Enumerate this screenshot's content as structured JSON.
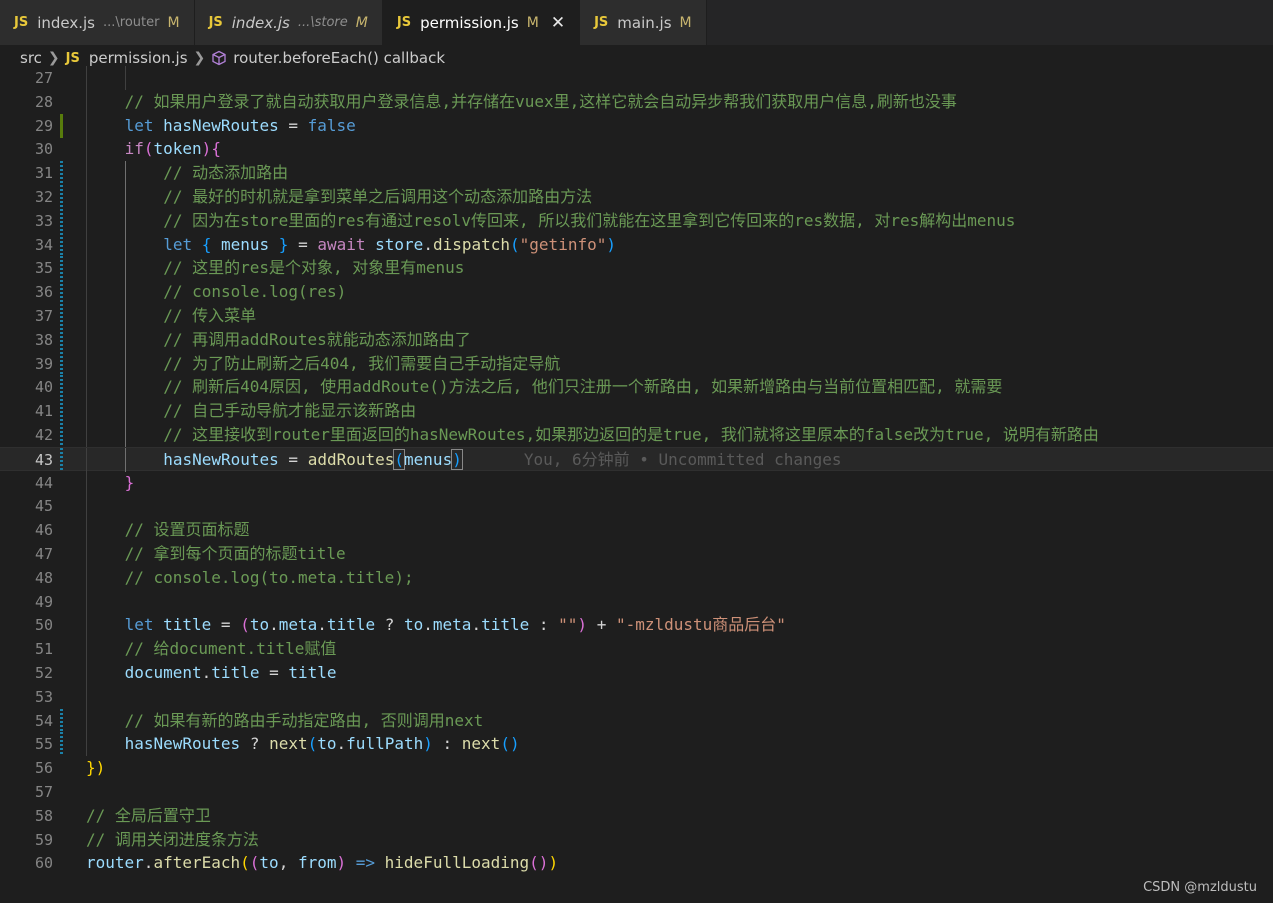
{
  "tabs": [
    {
      "icon": "JS",
      "name": "index.js",
      "path": "...\\router",
      "status": "M",
      "italic": false,
      "active": false
    },
    {
      "icon": "JS",
      "name": "index.js",
      "path": "...\\store",
      "status": "M",
      "italic": true,
      "active": false
    },
    {
      "icon": "JS",
      "name": "permission.js",
      "path": "",
      "status": "M",
      "italic": false,
      "active": true,
      "close": "✕"
    },
    {
      "icon": "JS",
      "name": "main.js",
      "path": "",
      "status": "M",
      "italic": false,
      "active": false
    }
  ],
  "breadcrumb": {
    "folder": "src",
    "file_icon": "JS",
    "file": "permission.js",
    "symbol_icon": "cube-icon",
    "symbol": "router.beforeEach() callback"
  },
  "editor": {
    "current_line": 43,
    "blame_text": "You, 6分钟前 • Uncommitted changes",
    "lines": [
      {
        "n": "27",
        "indent": 2,
        "tokens": []
      },
      {
        "n": "28",
        "indent": 1,
        "tokens": [
          {
            "t": "// 如果用户登录了就自动获取用户登录信息,并存储在vuex里,这样它就会自动异步帮我们获取用户信息,刷新也没事",
            "c": "c"
          }
        ]
      },
      {
        "n": "29",
        "indent": 1,
        "gutter": "added",
        "tokens": [
          {
            "t": "let ",
            "c": "k"
          },
          {
            "t": "hasNewRoutes",
            "c": "v"
          },
          {
            "t": " = ",
            "c": "p"
          },
          {
            "t": "false",
            "c": "k"
          }
        ]
      },
      {
        "n": "30",
        "indent": 1,
        "tokens": [
          {
            "t": "if",
            "c": "kc"
          },
          {
            "t": "(",
            "c": "b2"
          },
          {
            "t": "token",
            "c": "v"
          },
          {
            "t": ")",
            "c": "b2"
          },
          {
            "t": "{",
            "c": "b2"
          }
        ]
      },
      {
        "n": "31",
        "indent": 2,
        "gutter": "modified",
        "tokens": [
          {
            "t": "// 动态添加路由",
            "c": "c"
          }
        ]
      },
      {
        "n": "32",
        "indent": 2,
        "gutter": "modified",
        "tokens": [
          {
            "t": "// 最好的时机就是拿到菜单之后调用这个动态添加路由方法",
            "c": "c"
          }
        ]
      },
      {
        "n": "33",
        "indent": 2,
        "gutter": "modified",
        "tokens": [
          {
            "t": "// 因为在store里面的res有通过resolv传回来, 所以我们就能在这里拿到它传回来的res数据, 对res解构出menus",
            "c": "c"
          }
        ]
      },
      {
        "n": "34",
        "indent": 2,
        "gutter": "modified",
        "tokens": [
          {
            "t": "let ",
            "c": "k"
          },
          {
            "t": "{",
            "c": "b3"
          },
          {
            "t": " menus ",
            "c": "v"
          },
          {
            "t": "}",
            "c": "b3"
          },
          {
            "t": " = ",
            "c": "p"
          },
          {
            "t": "await ",
            "c": "kc"
          },
          {
            "t": "store",
            "c": "v"
          },
          {
            "t": ".",
            "c": "p"
          },
          {
            "t": "dispatch",
            "c": "f"
          },
          {
            "t": "(",
            "c": "b3"
          },
          {
            "t": "\"getinfo\"",
            "c": "s"
          },
          {
            "t": ")",
            "c": "b3"
          }
        ]
      },
      {
        "n": "35",
        "indent": 2,
        "gutter": "modified",
        "tokens": [
          {
            "t": "// 这里的res是个对象, 对象里有menus",
            "c": "c"
          }
        ]
      },
      {
        "n": "36",
        "indent": 2,
        "gutter": "modified",
        "tokens": [
          {
            "t": "// console.log(res)",
            "c": "c"
          }
        ]
      },
      {
        "n": "37",
        "indent": 2,
        "gutter": "modified",
        "tokens": [
          {
            "t": "// 传入菜单",
            "c": "c"
          }
        ]
      },
      {
        "n": "38",
        "indent": 2,
        "gutter": "modified",
        "tokens": [
          {
            "t": "// 再调用addRoutes就能动态添加路由了",
            "c": "c"
          }
        ]
      },
      {
        "n": "39",
        "indent": 2,
        "gutter": "modified",
        "tokens": [
          {
            "t": "// 为了防止刷新之后404, 我们需要自己手动指定导航",
            "c": "c"
          }
        ]
      },
      {
        "n": "40",
        "indent": 2,
        "gutter": "modified",
        "tokens": [
          {
            "t": "// 刷新后404原因, 使用addRoute()方法之后, 他们只注册一个新路由, 如果新增路由与当前位置相匹配, 就需要",
            "c": "c"
          }
        ]
      },
      {
        "n": "41",
        "indent": 2,
        "gutter": "modified",
        "tokens": [
          {
            "t": "// 自己手动导航才能显示该新路由",
            "c": "c"
          }
        ]
      },
      {
        "n": "42",
        "indent": 2,
        "gutter": "modified",
        "tokens": [
          {
            "t": "// 这里接收到router里面返回的hasNewRoutes,如果那边返回的是true, 我们就将这里原本的false改为true, 说明有新路由",
            "c": "c"
          }
        ]
      },
      {
        "n": "43",
        "indent": 2,
        "gutter": "modified",
        "tokens": [
          {
            "t": "hasNewRoutes",
            "c": "v"
          },
          {
            "t": " = ",
            "c": "p"
          },
          {
            "t": "addRoutes",
            "c": "f"
          },
          {
            "t": "(",
            "c": "b3 bm"
          },
          {
            "t": "menus",
            "c": "v"
          },
          {
            "t": ")",
            "c": "b3 bm"
          }
        ],
        "blame": true
      },
      {
        "n": "44",
        "indent": 1,
        "tokens": [
          {
            "t": "}",
            "c": "b2"
          }
        ]
      },
      {
        "n": "45",
        "indent": 1,
        "tokens": []
      },
      {
        "n": "46",
        "indent": 1,
        "tokens": [
          {
            "t": "// 设置页面标题",
            "c": "c"
          }
        ]
      },
      {
        "n": "47",
        "indent": 1,
        "tokens": [
          {
            "t": "// 拿到每个页面的标题title",
            "c": "c"
          }
        ]
      },
      {
        "n": "48",
        "indent": 1,
        "tokens": [
          {
            "t": "// console.log(to.meta.title);",
            "c": "c"
          }
        ]
      },
      {
        "n": "49",
        "indent": 1,
        "tokens": []
      },
      {
        "n": "50",
        "indent": 1,
        "tokens": [
          {
            "t": "let ",
            "c": "k"
          },
          {
            "t": "title",
            "c": "v"
          },
          {
            "t": " = ",
            "c": "p"
          },
          {
            "t": "(",
            "c": "b2"
          },
          {
            "t": "to",
            "c": "v"
          },
          {
            "t": ".",
            "c": "p"
          },
          {
            "t": "meta",
            "c": "v"
          },
          {
            "t": ".",
            "c": "p"
          },
          {
            "t": "title",
            "c": "v"
          },
          {
            "t": " ? ",
            "c": "p"
          },
          {
            "t": "to",
            "c": "v"
          },
          {
            "t": ".",
            "c": "p"
          },
          {
            "t": "meta",
            "c": "v"
          },
          {
            "t": ".",
            "c": "p"
          },
          {
            "t": "title",
            "c": "v"
          },
          {
            "t": " : ",
            "c": "p"
          },
          {
            "t": "\"\"",
            "c": "s"
          },
          {
            "t": ")",
            "c": "b2"
          },
          {
            "t": " + ",
            "c": "p"
          },
          {
            "t": "\"-mzldustu商品后台\"",
            "c": "s"
          }
        ]
      },
      {
        "n": "51",
        "indent": 1,
        "tokens": [
          {
            "t": "// 给document.title赋值",
            "c": "c"
          }
        ]
      },
      {
        "n": "52",
        "indent": 1,
        "tokens": [
          {
            "t": "document",
            "c": "v"
          },
          {
            "t": ".",
            "c": "p"
          },
          {
            "t": "title",
            "c": "v"
          },
          {
            "t": " = ",
            "c": "p"
          },
          {
            "t": "title",
            "c": "v"
          }
        ]
      },
      {
        "n": "53",
        "indent": 1,
        "tokens": []
      },
      {
        "n": "54",
        "indent": 1,
        "gutter": "modified",
        "tokens": [
          {
            "t": "// 如果有新的路由手动指定路由, 否则调用next",
            "c": "c"
          }
        ]
      },
      {
        "n": "55",
        "indent": 1,
        "gutter": "modified",
        "tokens": [
          {
            "t": "hasNewRoutes",
            "c": "v"
          },
          {
            "t": " ? ",
            "c": "p"
          },
          {
            "t": "next",
            "c": "f"
          },
          {
            "t": "(",
            "c": "b3"
          },
          {
            "t": "to",
            "c": "v"
          },
          {
            "t": ".",
            "c": "p"
          },
          {
            "t": "fullPath",
            "c": "v"
          },
          {
            "t": ")",
            "c": "b3"
          },
          {
            "t": " : ",
            "c": "p"
          },
          {
            "t": "next",
            "c": "f"
          },
          {
            "t": "()",
            "c": "b3"
          }
        ]
      },
      {
        "n": "56",
        "indent": 0,
        "tokens": [
          {
            "t": "}",
            "c": "b1"
          },
          {
            "t": ")",
            "c": "b1"
          }
        ]
      },
      {
        "n": "57",
        "indent": 0,
        "tokens": []
      },
      {
        "n": "58",
        "indent": 0,
        "tokens": [
          {
            "t": "// 全局后置守卫",
            "c": "c"
          }
        ]
      },
      {
        "n": "59",
        "indent": 0,
        "tokens": [
          {
            "t": "// 调用关闭进度条方法",
            "c": "c"
          }
        ]
      },
      {
        "n": "60",
        "indent": 0,
        "tokens": [
          {
            "t": "router",
            "c": "v"
          },
          {
            "t": ".",
            "c": "p"
          },
          {
            "t": "afterEach",
            "c": "f"
          },
          {
            "t": "(",
            "c": "b1"
          },
          {
            "t": "(",
            "c": "b2"
          },
          {
            "t": "to",
            "c": "v"
          },
          {
            "t": ", ",
            "c": "p"
          },
          {
            "t": "from",
            "c": "v"
          },
          {
            "t": ")",
            "c": "b2"
          },
          {
            "t": " => ",
            "c": "k"
          },
          {
            "t": "hideFullLoading",
            "c": "f"
          },
          {
            "t": "(",
            "c": "b2"
          },
          {
            "t": ")",
            "c": "b2"
          },
          {
            "t": ")",
            "c": "b1"
          }
        ]
      }
    ]
  },
  "watermark": "CSDN @mzldustu",
  "colors": {
    "background": "#1e1e1e",
    "comment": "#6a9955",
    "keyword": "#569cd6",
    "variable": "#9cdcfe",
    "function": "#dcdcaa",
    "string": "#ce9178"
  }
}
